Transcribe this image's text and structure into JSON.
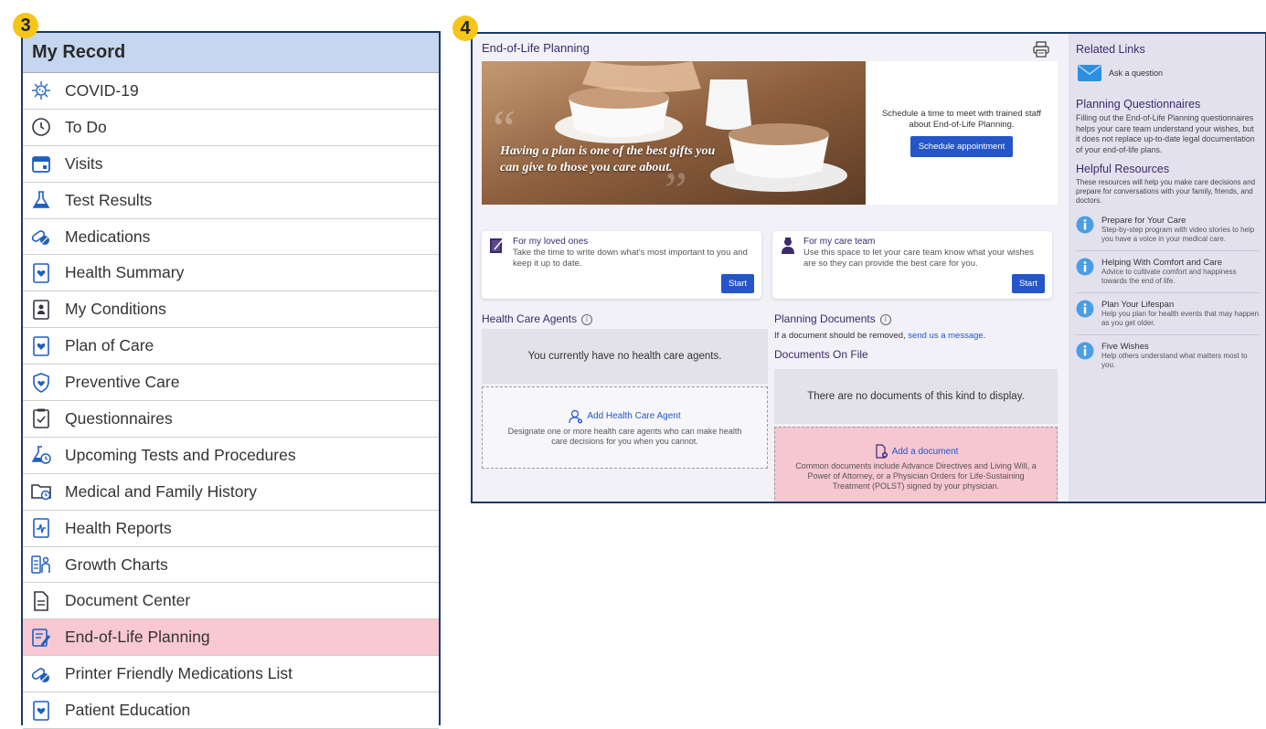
{
  "badges": {
    "left": "3",
    "right": "4"
  },
  "left_panel": {
    "header": "My Record",
    "items": [
      {
        "label": "COVID-19",
        "icon": "virus-icon",
        "active": false
      },
      {
        "label": "To Do",
        "icon": "clock-icon",
        "active": false
      },
      {
        "label": "Visits",
        "icon": "calendar-icon",
        "active": false
      },
      {
        "label": "Test Results",
        "icon": "flask-icon",
        "active": false
      },
      {
        "label": "Medications",
        "icon": "pills-icon",
        "active": false
      },
      {
        "label": "Health Summary",
        "icon": "heart-document-icon",
        "active": false
      },
      {
        "label": "My Conditions",
        "icon": "person-document-icon",
        "active": false
      },
      {
        "label": "Plan of Care",
        "icon": "heart-document-icon",
        "active": false
      },
      {
        "label": "Preventive Care",
        "icon": "shield-heart-icon",
        "active": false
      },
      {
        "label": "Questionnaires",
        "icon": "clipboard-check-icon",
        "active": false
      },
      {
        "label": "Upcoming Tests and Procedures",
        "icon": "flask-clock-icon",
        "active": false
      },
      {
        "label": "Medical and Family History",
        "icon": "folder-clock-icon",
        "active": false
      },
      {
        "label": "Health Reports",
        "icon": "pulse-document-icon",
        "active": false
      },
      {
        "label": "Growth Charts",
        "icon": "growth-chart-icon",
        "active": false
      },
      {
        "label": "Document Center",
        "icon": "document-icon",
        "active": false
      },
      {
        "label": "End-of-Life Planning",
        "icon": "document-pen-icon",
        "active": true
      },
      {
        "label": "Printer Friendly Medications List",
        "icon": "pills-icon",
        "active": false
      },
      {
        "label": "Patient Education",
        "icon": "heart-document-icon",
        "active": false
      }
    ]
  },
  "main": {
    "title": "End-of-Life Planning",
    "hero_quote": "Having a plan is one of the best gifts you can give to those you care about.",
    "schedule_text": "Schedule a time to meet with trained staff about End-of-Life Planning.",
    "schedule_button": "Schedule appointment",
    "cards": [
      {
        "title": "For my loved ones",
        "desc": "Take the time to write down what's most important to you and keep it up to date.",
        "button": "Start"
      },
      {
        "title": "For my care team",
        "desc": "Use this space to let your care team know what your wishes are so they can provide the best care for you.",
        "button": "Start"
      }
    ],
    "agents": {
      "title": "Health Care Agents",
      "empty": "You currently have no health care agents.",
      "add_link": "Add Health Care Agent",
      "add_desc": "Designate one or more health care agents who can make health care decisions for you when you cannot."
    },
    "documents": {
      "title": "Planning Documents",
      "note_prefix": "If a document should be removed,",
      "note_link": "send us a message",
      "note_suffix": ".",
      "on_file_title": "Documents On File",
      "empty": "There are no documents of this kind to display.",
      "add_link": "Add a document",
      "add_desc": "Common documents include Advance Directives and Living Will, a Power of Attorney, or a Physician Orders for Life-Sustaining Treatment (POLST) signed by your physician."
    }
  },
  "sidebar": {
    "related_title": "Related Links",
    "ask": "Ask a question",
    "questionnaires_title": "Planning Questionnaires",
    "questionnaires_text": "Filling out the End-of-Life Planning questionnaires helps your care team understand your wishes, but it does not replace up-to-date legal documentation of your end-of-life plans.",
    "resources_title": "Helpful Resources",
    "resources_text": "These resources will help you make care decisions and prepare for conversations with your family, friends, and doctors.",
    "resources": [
      {
        "title": "Prepare for Your Care",
        "desc": "Step-by-step program with video stories to help you have a voice in your medical care."
      },
      {
        "title": "Helping With Comfort and Care",
        "desc": "Advice to cultivate comfort and happiness towards the end of life."
      },
      {
        "title": "Plan Your Lifespan",
        "desc": "Help you plan for health events that may happen as you get older."
      },
      {
        "title": "Five Wishes",
        "desc": "Help others understand what matters most to you."
      }
    ]
  },
  "colors": {
    "accent": "#2456c9",
    "active_row": "#f8c8d3",
    "header_bg": "#c5d6ef",
    "frame": "#1b3a6b",
    "badge": "#f5c518"
  }
}
